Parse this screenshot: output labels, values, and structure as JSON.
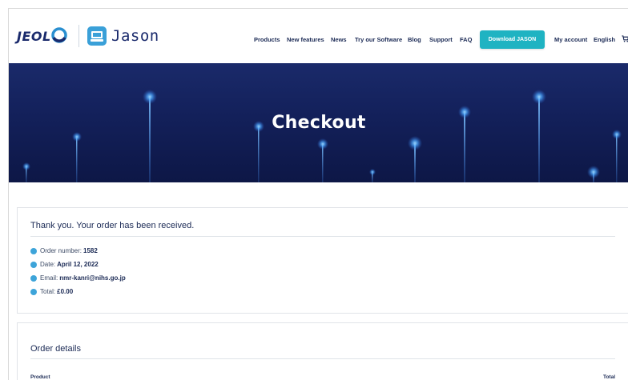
{
  "header": {
    "brand": "JEOL",
    "product": "Jason",
    "nav": [
      "Products",
      "New features",
      "News",
      "Try our Software",
      "Blog",
      "Support",
      "FAQ"
    ],
    "download_label": "Download JASON",
    "account_label": "My account",
    "language_label": "English",
    "cart_icon": "cart-icon"
  },
  "hero": {
    "title": "Checkout"
  },
  "order_received": {
    "heading": "Thank you. Your order has been received.",
    "rows": [
      {
        "label": "Order number:",
        "value": "1582"
      },
      {
        "label": "Date:",
        "value": "April 12, 2022"
      },
      {
        "label": "Email:",
        "value": "nmr-kanri@nihs.go.jp"
      },
      {
        "label": "Total:",
        "value": "£0.00"
      }
    ]
  },
  "order_details": {
    "heading": "Order details",
    "col_product": "Product",
    "col_total": "Total"
  },
  "colors": {
    "brand_navy": "#1b2a55",
    "accent_teal": "#1fb3c2",
    "bullet_blue": "#3da4d9",
    "hero_bg": "#13205a"
  }
}
